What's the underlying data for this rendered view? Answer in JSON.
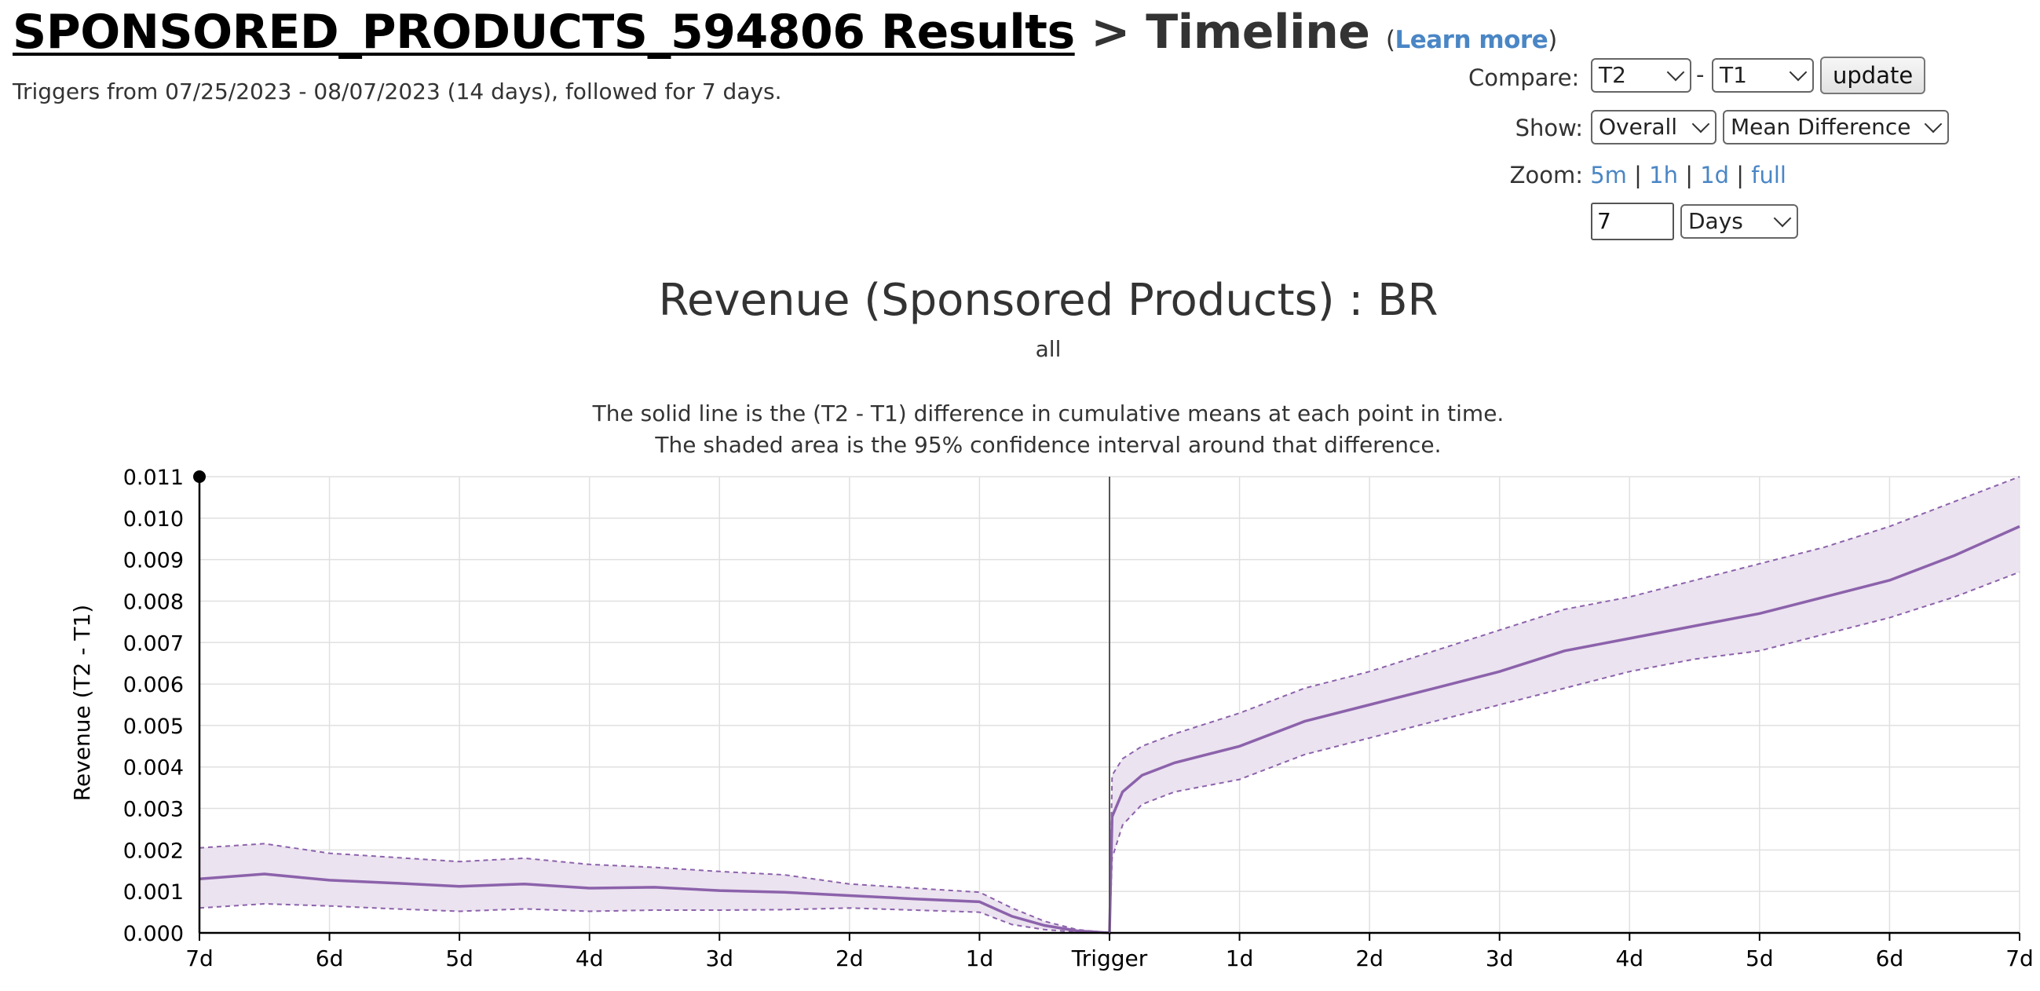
{
  "header": {
    "experiment_link": "SPONSORED_PRODUCTS_594806 Results",
    "separator": ">",
    "page_name": "Timeline",
    "learn_more_open": "(",
    "learn_more_label": "Learn more",
    "learn_more_close": ")",
    "subtitle": "Triggers from 07/25/2023 - 08/07/2023 (14 days), followed for 7 days."
  },
  "controls": {
    "compare_label": "Compare:",
    "compare_a": "T2",
    "compare_dash": "-",
    "compare_b": "T1",
    "update_label": "update",
    "show_label": "Show:",
    "show_scope": "Overall",
    "show_metric": "Mean Difference",
    "zoom_label": "Zoom:",
    "zoom_5m": "5m",
    "zoom_1h": "1h",
    "zoom_1d": "1d",
    "zoom_full": "full",
    "zoom_sep": "|",
    "zoom_value": "7",
    "zoom_unit": "Days"
  },
  "colors": {
    "line": "#8c62ab",
    "band": "#ebe3f0",
    "grid": "#e0e0e0",
    "axis": "#000000"
  },
  "chart_data": {
    "type": "area",
    "title": "Revenue (Sponsored Products) : BR",
    "subtitle": "all",
    "notes": [
      "The solid line is the (T2 - T1) difference in cumulative means at each point in time.",
      "The shaded area is the 95% confidence interval around that difference."
    ],
    "xlabel": "",
    "ylabel": "Revenue (T2 - T1)",
    "x_ticks": [
      "7d",
      "6d",
      "5d",
      "4d",
      "3d",
      "2d",
      "1d",
      "Trigger",
      "1d",
      "2d",
      "3d",
      "4d",
      "5d",
      "6d",
      "7d"
    ],
    "y_ticks": [
      "0.000",
      "0.001",
      "0.002",
      "0.003",
      "0.004",
      "0.005",
      "0.006",
      "0.007",
      "0.008",
      "0.009",
      "0.010",
      "0.011"
    ],
    "xlim_days": [
      -7,
      7
    ],
    "ylim": [
      0,
      0.011
    ],
    "grid": true,
    "x": [
      -7,
      -6.5,
      -6,
      -5.5,
      -5,
      -4.5,
      -4,
      -3.5,
      -3,
      -2.5,
      -2,
      -1.5,
      -1,
      -0.75,
      -0.5,
      -0.25,
      0,
      0.02,
      0.1,
      0.25,
      0.5,
      1,
      1.5,
      2,
      2.5,
      3,
      3.5,
      4,
      4.5,
      5,
      5.5,
      6,
      6.5,
      7
    ],
    "series": [
      {
        "role": "mean",
        "values": [
          0.0013,
          0.00142,
          0.00127,
          0.0012,
          0.00112,
          0.00118,
          0.00108,
          0.0011,
          0.00102,
          0.00098,
          0.0009,
          0.00082,
          0.00075,
          0.0004,
          0.00018,
          5e-05,
          0.0,
          0.0028,
          0.0034,
          0.0038,
          0.0041,
          0.0045,
          0.0051,
          0.0055,
          0.0059,
          0.0063,
          0.0068,
          0.0071,
          0.0074,
          0.0077,
          0.0081,
          0.0085,
          0.0091,
          0.0098
        ]
      },
      {
        "role": "upper",
        "values": [
          0.00205,
          0.00215,
          0.00192,
          0.00182,
          0.00172,
          0.0018,
          0.00165,
          0.00158,
          0.00148,
          0.0014,
          0.00118,
          0.00108,
          0.00098,
          0.0006,
          0.00028,
          8e-05,
          0.0,
          0.0038,
          0.0042,
          0.0045,
          0.0048,
          0.0053,
          0.0059,
          0.0063,
          0.0068,
          0.0073,
          0.0078,
          0.0081,
          0.0085,
          0.0089,
          0.0093,
          0.0098,
          0.0104,
          0.011
        ]
      },
      {
        "role": "lower",
        "values": [
          0.0006,
          0.0007,
          0.00065,
          0.00058,
          0.00052,
          0.00058,
          0.00052,
          0.00055,
          0.00055,
          0.00056,
          0.0006,
          0.00055,
          0.0005,
          0.0002,
          8e-05,
          2e-05,
          0.0,
          0.0018,
          0.0026,
          0.0031,
          0.0034,
          0.0037,
          0.0043,
          0.0047,
          0.0051,
          0.0055,
          0.0059,
          0.0063,
          0.0066,
          0.0068,
          0.0072,
          0.0076,
          0.0081,
          0.0087
        ]
      }
    ]
  }
}
